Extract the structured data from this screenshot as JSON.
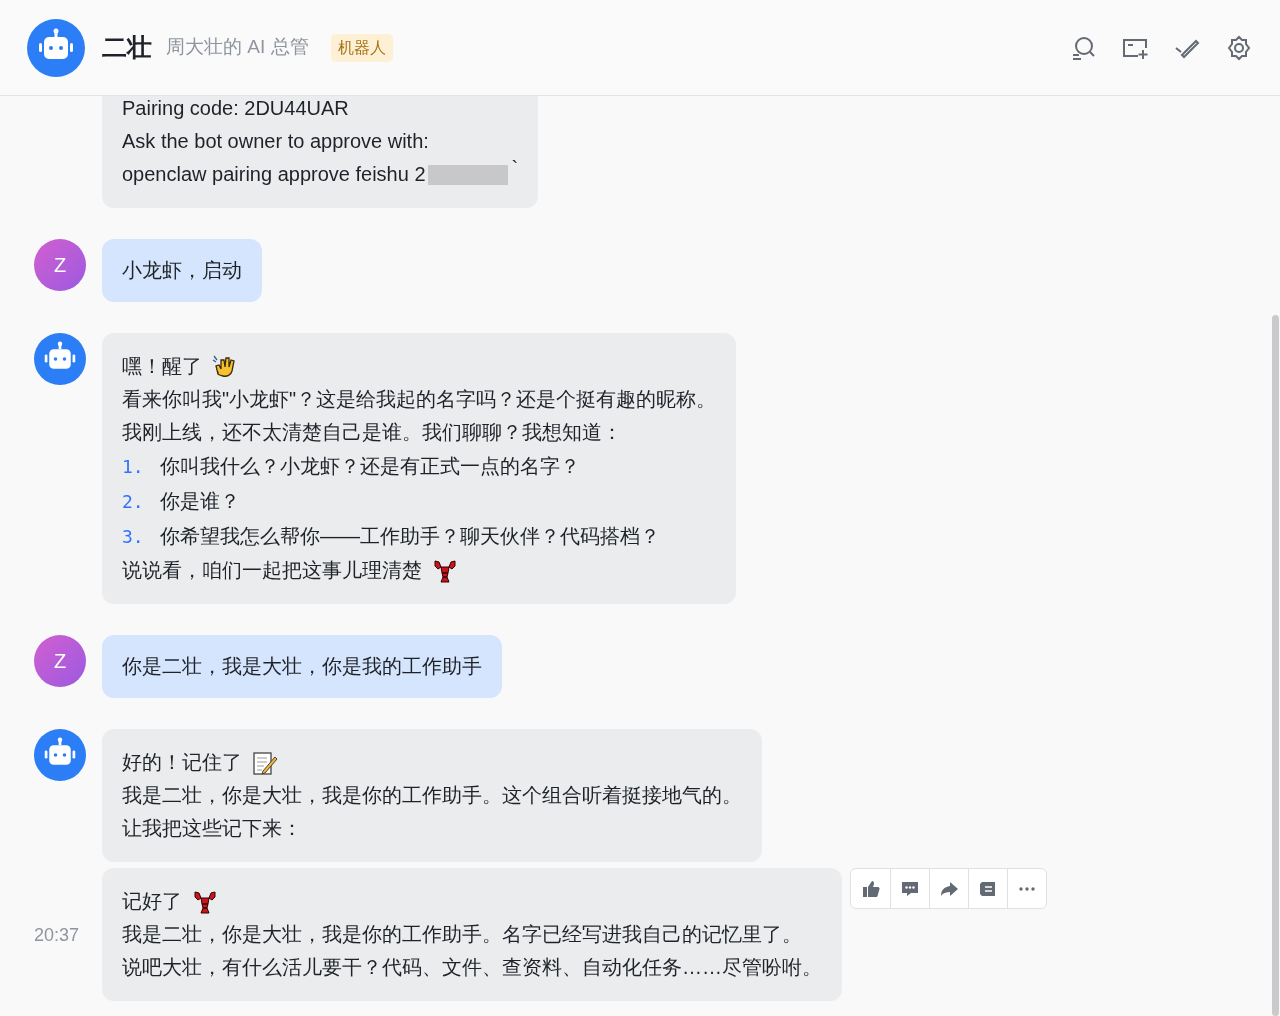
{
  "header": {
    "title": "二壮",
    "subtitle": "周大壮的 AI 总管",
    "badge": "机器人"
  },
  "messages": [
    {
      "kind": "bot",
      "avatar": false,
      "lines": [
        {
          "kind": "text",
          "text": "Pairing code: 2DU44UAR"
        },
        {
          "kind": "text",
          "text": "Ask the bot owner to approve with:"
        },
        {
          "kind": "redacted",
          "text": "openclaw pairing approve feishu 2",
          "tail": "`"
        }
      ]
    },
    {
      "kind": "user",
      "avatar": true,
      "initial": "Z",
      "lines": [
        {
          "kind": "text",
          "text": "小龙虾，启动"
        }
      ]
    },
    {
      "kind": "bot",
      "avatar": true,
      "lines": [
        {
          "kind": "text",
          "text": "嘿！醒了",
          "emoji": true
        },
        {
          "kind": "text",
          "text": "看来你叫我\"小龙虾\"？这是给我起的名字吗？还是个挺有趣的昵称。"
        },
        {
          "kind": "text",
          "text": "我刚上线，还不太清楚自己是谁。我们聊聊？我想知道："
        },
        {
          "kind": "numbered",
          "number": "1.",
          "text": "你叫我什么？小龙虾？还是有正式一点的名字？"
        },
        {
          "kind": "numbered",
          "number": "2.",
          "text": "你是谁？"
        },
        {
          "kind": "numbered",
          "number": "3.",
          "text": "你希望我怎么帮你——工作助手？聊天伙伴？代码搭档？"
        },
        {
          "kind": "text",
          "text": "说说看，咱们一起把这事儿理清楚",
          "emoji": true
        }
      ]
    },
    {
      "kind": "user",
      "avatar": true,
      "initial": "Z",
      "lines": [
        {
          "kind": "text",
          "text": "你是二壮，我是大壮，你是我的工作助手"
        }
      ]
    },
    {
      "kind": "bot",
      "avatar": true,
      "lines": [
        {
          "kind": "text",
          "text": "好的！记住了",
          "emoji": true
        },
        {
          "kind": "text",
          "text": "我是二壮，你是大壮，我是你的工作助手。这个组合听着挺接地气的。"
        },
        {
          "kind": "text",
          "text": "让我把这些记下来："
        }
      ]
    },
    {
      "kind": "bot",
      "avatar": false,
      "time": "20:37",
      "actions": true,
      "lines": [
        {
          "kind": "text",
          "text": "记好了",
          "emoji": true
        },
        {
          "kind": "text",
          "text": "我是二壮，你是大壮，我是你的工作助手。名字已经写进我自己的记忆里了。"
        },
        {
          "kind": "text",
          "text": "说吧大壮，有什么活儿要干？代码、文件、查资料、自动化任务……尽管吩咐。"
        }
      ]
    }
  ]
}
